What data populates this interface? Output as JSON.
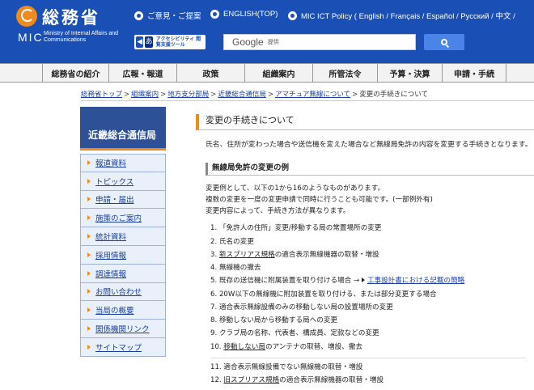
{
  "header": {
    "logo_kanji": "総務省",
    "logo_abbr": "MIC",
    "logo_en": "Ministry of Internal Affairs and Communications",
    "top_links": [
      "ご意見・ご提案",
      "ENGLISH(TOP)",
      "MIC ICT Policy ( English / Français / Español / Русский / 中文 /"
    ],
    "accessibility_label": "アクセシビリティ 閲覧支援ツール",
    "search_brand": "Google",
    "search_placeholder": "提供"
  },
  "nav": [
    "総務省の紹介",
    "広報・報道",
    "政策",
    "組織案内",
    "所管法令",
    "予算・決算",
    "申請・手続"
  ],
  "breadcrumb": [
    "総務省トップ",
    "組織案内",
    "地方支分部局",
    "近畿総合通信局",
    "アマチュア無線について"
  ],
  "breadcrumb_current": "変更の手続きについて",
  "sidebar": {
    "title": "近畿総合通信局",
    "items": [
      "報道資料",
      "トピックス",
      "申請・届出",
      "施策のご案内",
      "統計資料",
      "採用情報",
      "調達情報",
      "お問い合わせ",
      "当局の概要",
      "関係機関リンク",
      "サイトマップ"
    ]
  },
  "main": {
    "title": "変更の手続きについて",
    "intro": "氏名、住所が変わった場合や送信機を変えた場合など無線局免許の内容を変更する手続きとなります。",
    "sub_heading": "無線局免許の変更の例",
    "paragraphs": [
      "変更例として、以下の1から16のようなものがあります。",
      "複数の変更を一度の変更申請で同時に行うことも可能です。(一部例外有)",
      "変更内容によって、手続き方法が異なります。"
    ],
    "list": [
      {
        "num": "1.",
        "text": "「免許人の住所」変更/移動する局の常置場所の変更"
      },
      {
        "num": "2.",
        "text": "氏名の変更"
      },
      {
        "num": "3.",
        "u": "新スプリアス規格",
        "text": "の適合表示無線機器の取替・増設"
      },
      {
        "num": "4.",
        "text": "無線機の撤去"
      },
      {
        "num": "5.",
        "text": "既存の送信機に附属装置を取り付ける場合 → ",
        "link": "工事設計書における記載の簡略"
      },
      {
        "num": "6.",
        "text": "20W以下の無線機に附加装置を取り付ける、または部分変更する場合"
      },
      {
        "num": "7.",
        "text": "適合表示無線設備のみの移動しない局の設置場所の変更"
      },
      {
        "num": "8.",
        "text": "移動しない局から移動する局への変更"
      },
      {
        "num": "9.",
        "text": "クラブ局の名称、代表者、構成員、定款などの変更"
      },
      {
        "num": "10.",
        "u": "移動しない局",
        "text": "のアンテナの取替、増設、撤去"
      },
      {
        "num": "11.",
        "text": "適合表示無線設備でない無線機の取替・増設"
      },
      {
        "num": "12.",
        "u": "旧スプリアス規格",
        "text": "の適合表示無線機器の取替・増設"
      }
    ]
  }
}
